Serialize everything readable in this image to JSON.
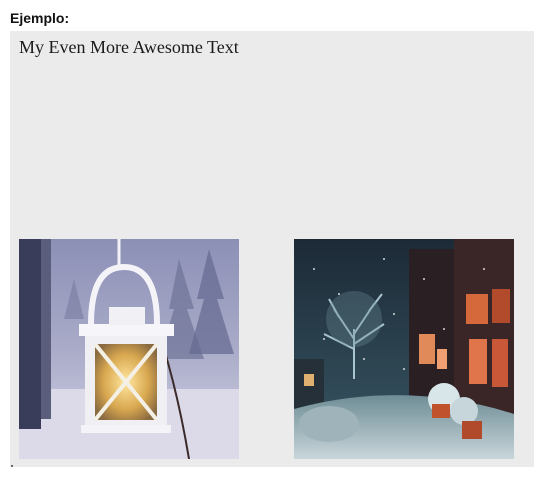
{
  "example": {
    "label": "Ejemplo:",
    "text": "My Even More Awesome Text"
  },
  "images": [
    {
      "icon": "winter-lantern-photo"
    },
    {
      "icon": "snowy-street-night-photo"
    }
  ],
  "colors": {
    "panel_background": "#ebebeb",
    "page_background": "#ffffff"
  }
}
